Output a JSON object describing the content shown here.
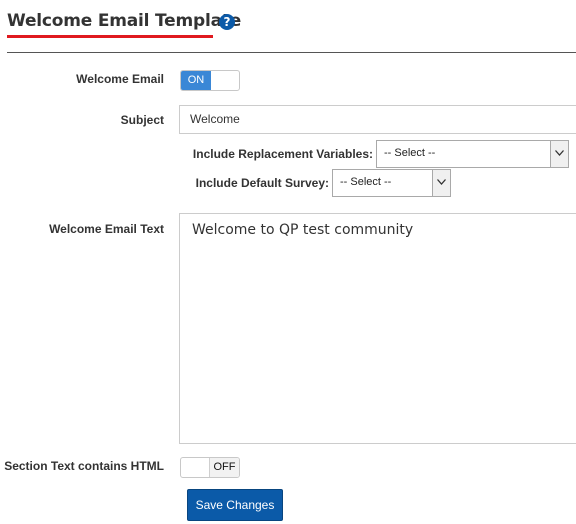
{
  "header": {
    "title": "Welcome Email Template",
    "help_icon": "question-circle-icon",
    "help_glyph": "?",
    "underline_color": "#e0191f"
  },
  "form": {
    "welcome_email": {
      "label": "Welcome Email",
      "state": "ON",
      "on_label": "ON"
    },
    "subject": {
      "label": "Subject",
      "value": "Welcome"
    },
    "replacement_variables": {
      "label": "Include Replacement Variables:",
      "selected": "-- Select --"
    },
    "default_survey": {
      "label": "Include Default Survey:",
      "selected": "-- Select --"
    },
    "welcome_email_text": {
      "label": "Welcome Email Text",
      "value": "Welcome to QP test community"
    },
    "section_text_html": {
      "label": "Section Text contains HTML",
      "state": "OFF",
      "off_label": "OFF"
    }
  },
  "actions": {
    "save_label": "Save Changes"
  },
  "colors": {
    "accent": "#0b5aa8",
    "toggle_on": "#3a87d6"
  }
}
